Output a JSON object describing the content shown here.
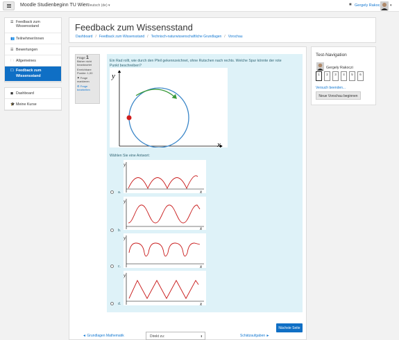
{
  "navbar": {
    "brand": "Moodle Studienbeginn TU Wien",
    "language": "Deutsch (de)",
    "language_caret": "▾",
    "user_name": "Gergely Rakoczi",
    "user_caret": "▾"
  },
  "sidebar": {
    "course_items": [
      {
        "icon": "☰",
        "label1": "Feedback zum",
        "label2": "Wissensstand",
        "active": false
      },
      {
        "icon": "👥",
        "label1": "Teilnehmer/innen",
        "active": false
      },
      {
        "icon": "☰",
        "label1": "Bewertungen",
        "active": false
      },
      {
        "icon": "🗀",
        "label1": "Allgemeines",
        "active": false
      },
      {
        "icon": "🗀",
        "label1": "Feedback zum",
        "label2": "Wissensstand",
        "active": true
      }
    ],
    "site_items": [
      {
        "icon": "◼",
        "label1": "Dashboard"
      },
      {
        "icon": "🎓",
        "label1": "Meine Kurse"
      }
    ]
  },
  "header": {
    "title": "Feedback zum Wissensstand",
    "breadcrumb": [
      "Dashboard",
      "Feedback zum Wissensstand",
      "Technisch-naturwissenschaftliche Grundlagen",
      "Vorschau"
    ]
  },
  "question_info": {
    "label": "Frage",
    "number": "1",
    "status": "Bisher nicht beantwortet",
    "points": "Erreichbare Punkte: 1,00",
    "flag": "Frage markieren",
    "edit": "Frage bearbeiten"
  },
  "question": {
    "text": "Ein Rad rollt, wie durch den Pfeil gekennzeichnet, ohne Rutschen nach rechts. Welche Spur könnte der rote Punkt beschreiben?",
    "prompt": "Wählen Sie eine Antwort:",
    "axis_x": "x",
    "axis_y": "y",
    "options": [
      {
        "label": "a."
      },
      {
        "label": "b."
      },
      {
        "label": "c."
      },
      {
        "label": "d."
      }
    ]
  },
  "nav_buttons": {
    "next_page": "Nächste Seite",
    "prev_activity": "◄ Grundlagen Mathematik",
    "jump_to": "Direkt zu:",
    "jump_caret": "⬍",
    "next_activity": "Schätzaufgaben ►"
  },
  "test_navigation": {
    "title": "Test-Navigation",
    "user_name": "Gergely Rakoczi",
    "question_numbers": [
      "1",
      "2",
      "3",
      "4",
      "5",
      "6"
    ],
    "finish_link": "Versuch beenden...",
    "new_preview": "Neue Vorschau beginnen"
  },
  "colors": {
    "accent": "#0f6fc5",
    "link": "#1177d1",
    "question_bg": "#def2f8",
    "wheel": "#3a86c8",
    "arrow": "#3a9a3a",
    "dot": "#d01c1c",
    "curve": "#c81818"
  }
}
